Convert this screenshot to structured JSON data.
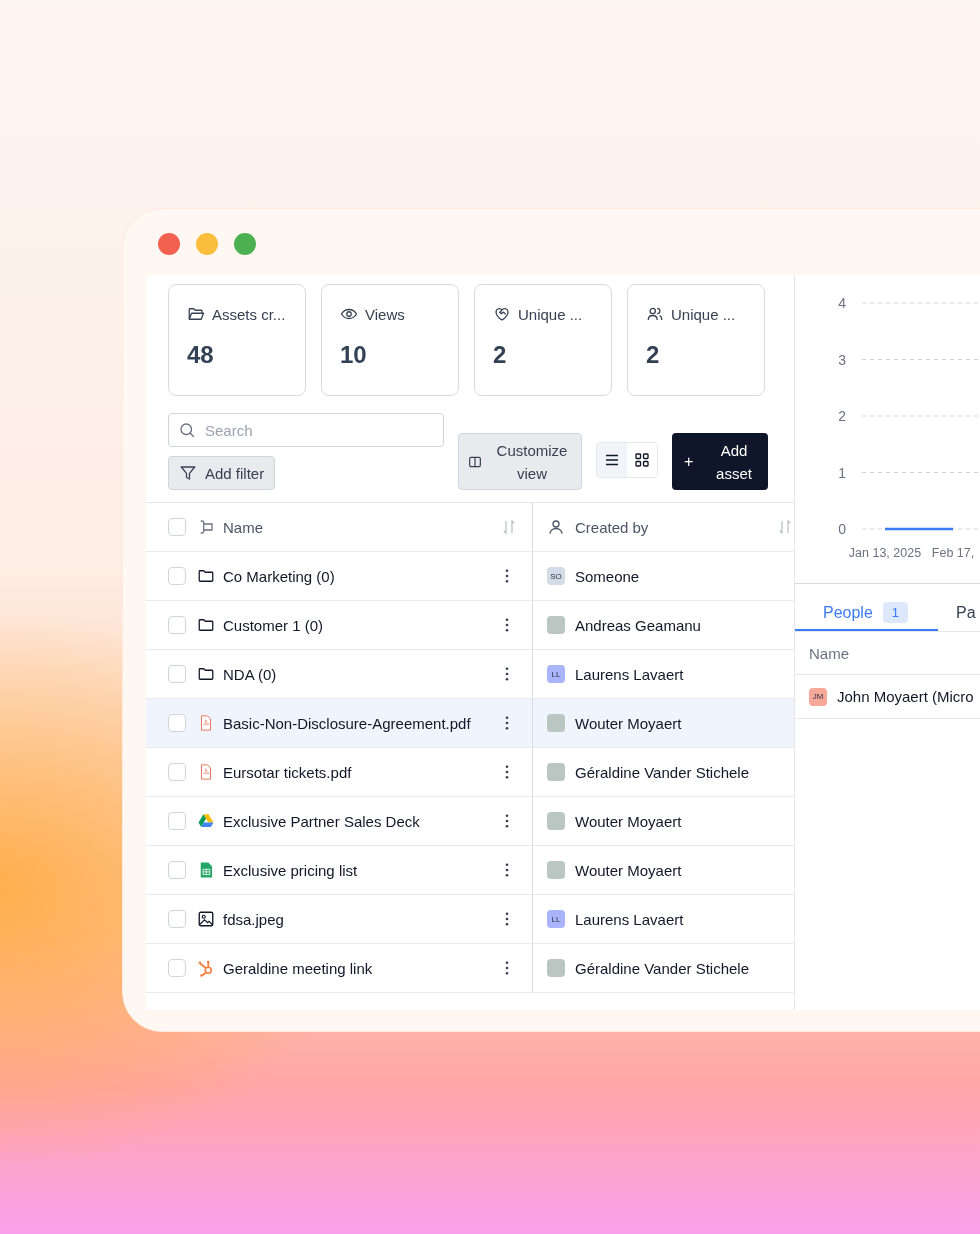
{
  "stats": [
    {
      "kind": "folder",
      "label": "Assets cr...",
      "value": "48"
    },
    {
      "kind": "eye",
      "label": "Views",
      "value": "10"
    },
    {
      "kind": "heart",
      "label": "Unique ...",
      "value": "2"
    },
    {
      "kind": "users",
      "label": "Unique ...",
      "value": "2"
    }
  ],
  "search": {
    "placeholder": "Search"
  },
  "add_filter": "Add filter",
  "customize_view": "Customize view",
  "view_toggle": [
    {
      "kind": "list",
      "selected": true
    },
    {
      "kind": "grid",
      "selected": false
    }
  ],
  "add_asset": {
    "icon": "+",
    "label": "Add asset"
  },
  "table": {
    "columns": [
      {
        "label": "Name",
        "checked": false
      },
      {
        "label": "Created by"
      }
    ],
    "rows": [
      {
        "checked": false,
        "selected": false,
        "kind": "folder",
        "name": "Co Marketing (0)",
        "creator": {
          "kind": "initials",
          "initials": "SO",
          "color": "#d3dbe6",
          "name": "Someone"
        }
      },
      {
        "checked": false,
        "selected": false,
        "kind": "folder",
        "name": "Customer 1 (0)",
        "creator": {
          "kind": "photo",
          "name": "Andreas Geamanu"
        }
      },
      {
        "checked": false,
        "selected": false,
        "kind": "folder",
        "name": "NDA (0)",
        "creator": {
          "kind": "initials",
          "initials": "LL",
          "color": "#a9b4fb",
          "name": "Laurens Lavaert"
        }
      },
      {
        "checked": false,
        "selected": true,
        "kind": "pdf",
        "name": "Basic-Non-Disclosure-Agreement.pdf",
        "creator": {
          "kind": "photo",
          "name": "Wouter Moyaert"
        }
      },
      {
        "checked": false,
        "selected": false,
        "kind": "pdf",
        "name": "Eursotar tickets.pdf",
        "creator": {
          "kind": "photo",
          "name": "Géraldine Vander Stichele"
        }
      },
      {
        "checked": false,
        "selected": false,
        "kind": "drive",
        "name": "Exclusive Partner Sales Deck",
        "creator": {
          "kind": "photo",
          "name": "Wouter Moyaert"
        }
      },
      {
        "checked": false,
        "selected": false,
        "kind": "sheet",
        "name": "Exclusive pricing list",
        "creator": {
          "kind": "photo",
          "name": "Wouter Moyaert"
        }
      },
      {
        "checked": false,
        "selected": false,
        "kind": "image",
        "name": "fdsa.jpeg",
        "creator": {
          "kind": "initials",
          "initials": "LL",
          "color": "#a9b4fb",
          "name": "Laurens Lavaert"
        }
      },
      {
        "checked": false,
        "selected": false,
        "kind": "hubspot",
        "name": "Geraldine meeting link",
        "creator": {
          "kind": "photo",
          "name": "Géraldine Vander Stichele"
        }
      }
    ]
  },
  "chart": {
    "chart_data": {
      "type": "line",
      "grid": true,
      "x": [
        "Jan 13, 2025",
        "Feb 17,"
      ],
      "yticks": [
        0,
        1,
        2,
        3,
        4
      ],
      "ylim": [
        0,
        4
      ],
      "series": [
        {
          "color": "#3b7bf6",
          "values": [
            0,
            0
          ]
        }
      ]
    }
  },
  "tabs": [
    {
      "label": "People",
      "count": "1",
      "selected": true
    },
    {
      "label": "Pa",
      "selected": false
    }
  ],
  "people": {
    "columns": [
      "Name"
    ],
    "rows": [
      {
        "initials": "JM",
        "color": "#f6a899",
        "name": "John Moyaert (Micro"
      }
    ]
  }
}
